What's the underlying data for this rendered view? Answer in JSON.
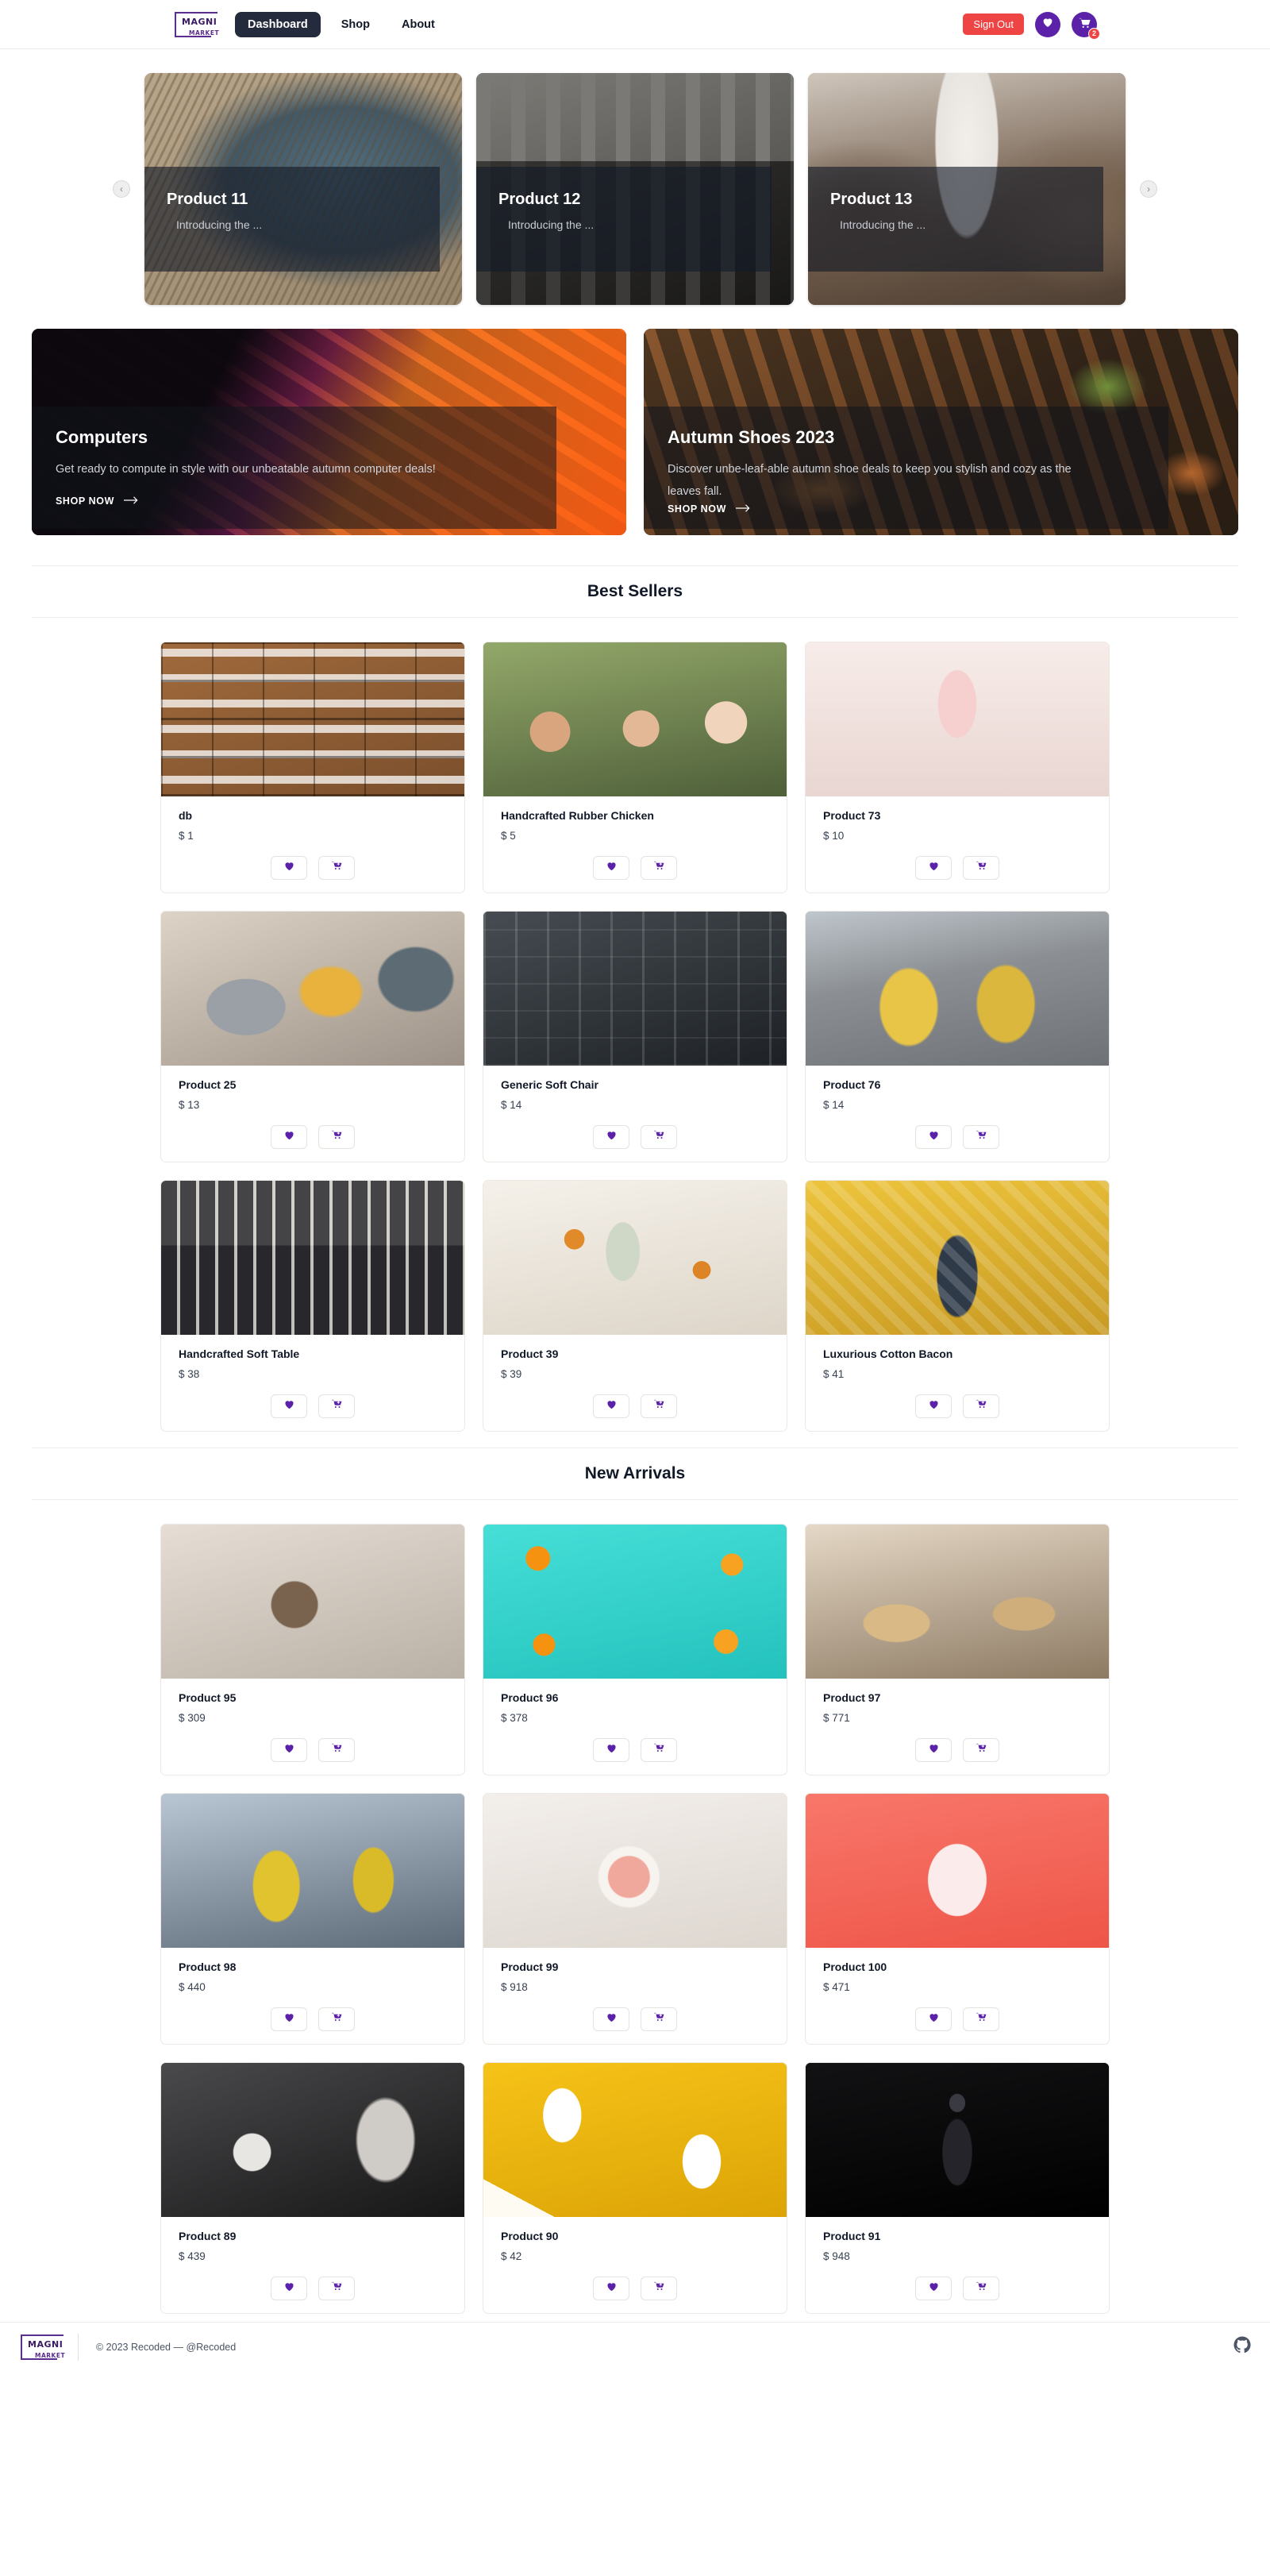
{
  "brand": {
    "name_line1": "MAGNI",
    "name_line2": "MARKET",
    "accent": "#5b21a8",
    "danger": "#ef4444",
    "dark": "#242b3d"
  },
  "header": {
    "nav": [
      {
        "label": "Dashboard",
        "active": true
      },
      {
        "label": "Shop",
        "active": false
      },
      {
        "label": "About",
        "active": false
      }
    ],
    "sign_out_label": "Sign Out",
    "wishlist_icon": "heart-icon",
    "cart_icon": "shopping-cart-icon",
    "cart_count": "2"
  },
  "carousel": {
    "prev_icon": "chevron-left-icon",
    "next_icon": "chevron-right-icon",
    "slides": [
      {
        "title": "Product 11",
        "subtitle": "Introducing the ...",
        "photo": "ph-phone"
      },
      {
        "title": "Product 12",
        "subtitle": "Introducing the ...",
        "photo": "ph-build"
      },
      {
        "title": "Product 13",
        "subtitle": "Introducing the ...",
        "photo": "ph-cloth"
      }
    ]
  },
  "promos": [
    {
      "title": "Computers",
      "description": "Get ready to compute in style with our unbeatable autumn computer deals!",
      "cta": "SHOP NOW",
      "cta_icon": "arrow-right-icon",
      "photo": "ph-keyboard"
    },
    {
      "title": "Autumn Shoes 2023",
      "description": "Discover unbe-leaf-able autumn shoe deals to keep you stylish and cozy as the leaves fall.",
      "cta": "SHOP NOW",
      "cta_icon": "arrow-right-icon",
      "photo": "ph-leaves"
    }
  ],
  "sections": [
    {
      "heading": "Best Sellers",
      "products": [
        {
          "name": "db",
          "price": "$ 1",
          "thumb": "th-drawers"
        },
        {
          "name": "Handcrafted Rubber Chicken",
          "price": "$ 5",
          "thumb": "th-family"
        },
        {
          "name": "Product 73",
          "price": "$ 10",
          "thumb": "th-perfume"
        },
        {
          "name": "Product 25",
          "price": "$ 13",
          "thumb": "th-scarf"
        },
        {
          "name": "Generic Soft Chair",
          "price": "$ 14",
          "thumb": "th-chair"
        },
        {
          "name": "Product 76",
          "price": "$ 14",
          "thumb": "th-yellow"
        },
        {
          "name": "Handcrafted Soft Table",
          "price": "$ 38",
          "thumb": "th-desk"
        },
        {
          "name": "Product 39",
          "price": "$ 39",
          "thumb": "th-bottles"
        },
        {
          "name": "Luxurious Cotton Bacon",
          "price": "$ 41",
          "thumb": "th-kid"
        }
      ]
    },
    {
      "heading": "New Arrivals",
      "products": [
        {
          "name": "Product 95",
          "price": "$ 309",
          "thumb": "th-headphone"
        },
        {
          "name": "Product 96",
          "price": "$ 378",
          "thumb": "th-orange"
        },
        {
          "name": "Product 97",
          "price": "$ 771",
          "thumb": "th-bakery"
        },
        {
          "name": "Product 98",
          "price": "$ 440",
          "thumb": "th-dance"
        },
        {
          "name": "Product 99",
          "price": "$ 918",
          "thumb": "th-bowl"
        },
        {
          "name": "Product 100",
          "price": "$ 471",
          "thumb": "th-cup"
        },
        {
          "name": "Product 89",
          "price": "$ 439",
          "thumb": "th-bag"
        },
        {
          "name": "Product 90",
          "price": "$ 42",
          "thumb": "th-milk"
        },
        {
          "name": "Product 91",
          "price": "$ 948",
          "thumb": "th-dark-perfume"
        }
      ]
    }
  ],
  "card_actions": {
    "wishlist_icon": "heart-icon",
    "add_to_cart_icon": "cart-plus-icon"
  },
  "footer": {
    "copyright": "© 2023 Recoded — @Recoded",
    "github_icon": "github-icon"
  }
}
